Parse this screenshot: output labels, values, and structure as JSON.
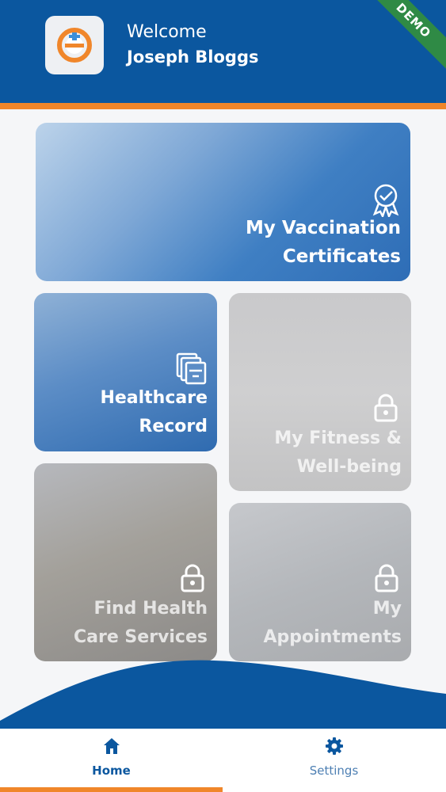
{
  "header": {
    "welcome": "Welcome",
    "username": "Joseph Bloggs",
    "badge": "DEMO",
    "logo_icon": "app-logo-e"
  },
  "tiles": [
    {
      "label_line1": "My Vaccination",
      "label_line2": "Certificates",
      "icon": "certificate-badge-icon",
      "locked": false
    },
    {
      "label_line1": "Healthcare",
      "label_line2": "Record",
      "icon": "records-folder-icon",
      "locked": false
    },
    {
      "label_line1": "My Fitness &",
      "label_line2": "Well-being",
      "icon": "lock-icon",
      "locked": true
    },
    {
      "label_line1": "Find Health",
      "label_line2": "Care Services",
      "icon": "lock-icon",
      "locked": true
    },
    {
      "label_line1": "My",
      "label_line2": "Appointments",
      "icon": "lock-icon",
      "locked": true
    }
  ],
  "tabbar": {
    "home": "Home",
    "settings": "Settings",
    "active": "home"
  },
  "colors": {
    "primary": "#0b579f",
    "accent": "#f0862a",
    "demo_ribbon": "#2f8a45"
  }
}
